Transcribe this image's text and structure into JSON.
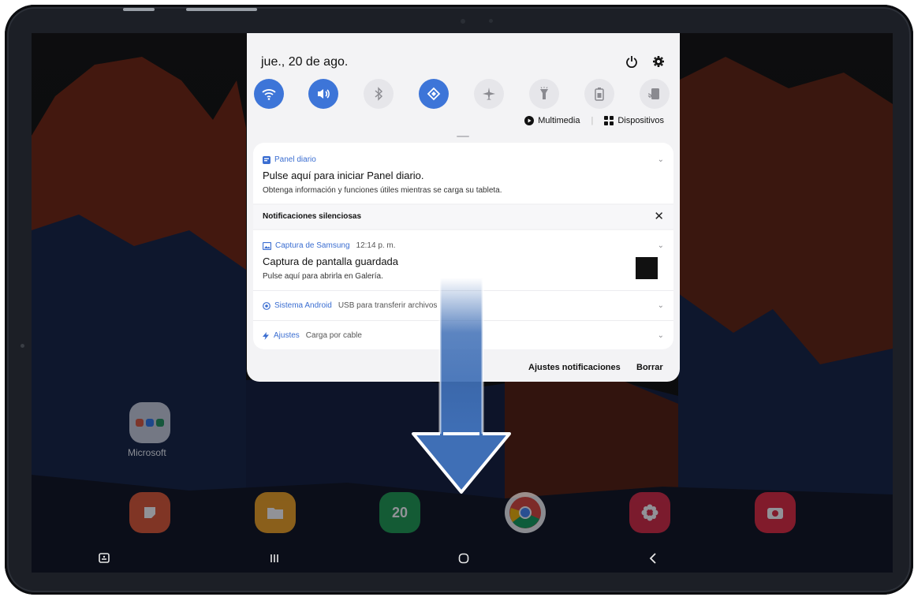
{
  "qs_panel": {
    "date": "jue., 20 de ago.",
    "multimedia_label": "Multimedia",
    "dispositivos_label": "Dispositivos",
    "toggles": [
      {
        "icon": "wifi-icon",
        "active": true
      },
      {
        "icon": "volume-icon",
        "active": true
      },
      {
        "icon": "bluetooth-icon",
        "active": false
      },
      {
        "icon": "auto-rotate-icon",
        "active": true
      },
      {
        "icon": "airplane-icon",
        "active": false
      },
      {
        "icon": "flashlight-icon",
        "active": false
      },
      {
        "icon": "power-saving-icon",
        "active": false
      },
      {
        "icon": "screen-mirror-icon",
        "active": false
      }
    ]
  },
  "notifications": {
    "daily_panel": {
      "app": "Panel diario",
      "title": "Pulse aquí para iniciar Panel diario.",
      "body": "Obtenga información y funciones útiles mientras se carga su tableta."
    },
    "silent_header": "Notificaciones silenciosas",
    "screenshot": {
      "app": "Captura de Samsung",
      "time": "12:14 p. m.",
      "title": "Captura de pantalla guardada",
      "body": "Pulse aquí para abrirla en Galería."
    },
    "android_system": {
      "app": "Sistema Android",
      "text": "USB para transferir archivos"
    },
    "settings": {
      "app": "Ajustes",
      "text": "Carga por cable"
    },
    "settings_button": "Ajustes notificaciones",
    "clear_button": "Borrar"
  },
  "home": {
    "folder_label": "Microsoft",
    "calendar_day": "20"
  },
  "colors": {
    "accent": "#3d75d8",
    "arrow": "#3f6fb6"
  }
}
